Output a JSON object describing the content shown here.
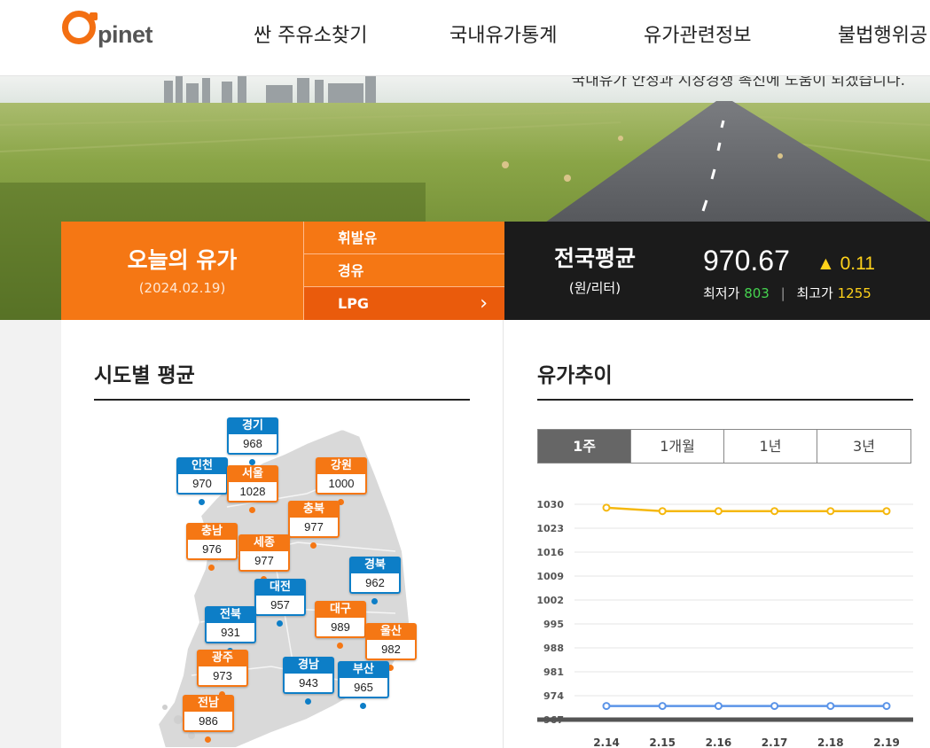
{
  "header": {
    "logo_text": "pinet",
    "nav": [
      "싼 주유소찾기",
      "국내유가통계",
      "유가관련정보",
      "불법행위공"
    ]
  },
  "hero": {
    "caption": "국내유가 안정과 시장경쟁 촉진에 도움이 되겠습니다."
  },
  "today": {
    "title": "오늘의 유가",
    "date": "(2024.02.19)",
    "fuel_tabs": [
      "휘발유",
      "경유",
      "LPG"
    ],
    "active_tab": "LPG",
    "tab_arrow": "›"
  },
  "national": {
    "label": "전국평균",
    "unit": "(원/리터)",
    "price": "970.67",
    "change_icon": "triangle-up-icon",
    "change": "▲ 0.11",
    "min_label": "최저가",
    "min": "803",
    "separator": "|",
    "max_label": "최고가",
    "max": "1255"
  },
  "regions_section": {
    "title": "시도별 평균",
    "regions": [
      {
        "name": "경기",
        "value": "968",
        "color": "blue"
      },
      {
        "name": "인천",
        "value": "970",
        "color": "blue"
      },
      {
        "name": "서울",
        "value": "1028",
        "color": "orange"
      },
      {
        "name": "강원",
        "value": "1000",
        "color": "orange"
      },
      {
        "name": "충북",
        "value": "977",
        "color": "orange"
      },
      {
        "name": "충남",
        "value": "976",
        "color": "orange"
      },
      {
        "name": "세종",
        "value": "977",
        "color": "orange"
      },
      {
        "name": "경북",
        "value": "962",
        "color": "blue"
      },
      {
        "name": "대전",
        "value": "957",
        "color": "blue"
      },
      {
        "name": "전북",
        "value": "931",
        "color": "blue"
      },
      {
        "name": "대구",
        "value": "989",
        "color": "orange"
      },
      {
        "name": "울산",
        "value": "982",
        "color": "orange"
      },
      {
        "name": "광주",
        "value": "973",
        "color": "orange"
      },
      {
        "name": "경남",
        "value": "943",
        "color": "blue"
      },
      {
        "name": "부산",
        "value": "965",
        "color": "blue"
      },
      {
        "name": "전남",
        "value": "986",
        "color": "orange"
      }
    ]
  },
  "trend_section": {
    "title": "유가추이",
    "tabs": [
      "1주",
      "1개월",
      "1년",
      "3년"
    ],
    "active_tab": "1주"
  },
  "chart_data": {
    "type": "line",
    "x": [
      "2.14",
      "2.15",
      "2.16",
      "2.17",
      "2.18",
      "2.19"
    ],
    "yticks": [
      967,
      974,
      981,
      988,
      995,
      1002,
      1009,
      1016,
      1023,
      1030
    ],
    "ylim": [
      967,
      1030
    ],
    "series": [
      {
        "values": [
          1029,
          1028,
          1028,
          1028,
          1028,
          1028
        ],
        "color": "#f5b80f"
      },
      {
        "values": [
          971,
          971,
          971,
          971,
          971,
          971
        ],
        "color": "#5b94e8"
      }
    ],
    "grid": true
  },
  "colors": {
    "accent_orange": "#f57714",
    "dark_orange": "#ea5b0c",
    "region_blue": "#0d7ec7",
    "dark_panel": "#1b1b1b"
  }
}
